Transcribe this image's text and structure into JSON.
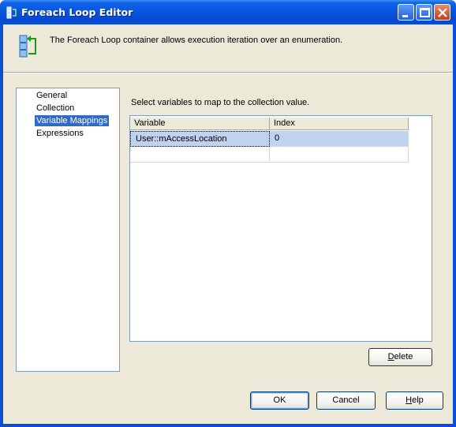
{
  "window": {
    "title": "Foreach Loop Editor"
  },
  "header": {
    "description": "The Foreach Loop container allows execution iteration over an enumeration."
  },
  "nav": {
    "items": [
      {
        "label": "General",
        "selected": false
      },
      {
        "label": "Collection",
        "selected": false
      },
      {
        "label": "Variable Mappings",
        "selected": true
      },
      {
        "label": "Expressions",
        "selected": false
      }
    ]
  },
  "main": {
    "prompt": "Select variables to map to the collection value.",
    "columns": [
      "Variable",
      "Index"
    ],
    "rows": [
      {
        "variable": "User::mAccessLocation",
        "index": "0"
      },
      {
        "variable": "",
        "index": ""
      }
    ],
    "delete_label": "Delete",
    "delete_mnemonic": "D",
    "delete_rest": "elete"
  },
  "footer": {
    "ok_label": "OK",
    "cancel_label": "Cancel",
    "help_label": "Help",
    "help_mnemonic": "H",
    "help_rest": "elp"
  },
  "colors": {
    "titlebar": "#0a55e0",
    "dialog": "#ece9d8",
    "selection": "#316ac5",
    "row_selection": "#c1d2ee"
  }
}
